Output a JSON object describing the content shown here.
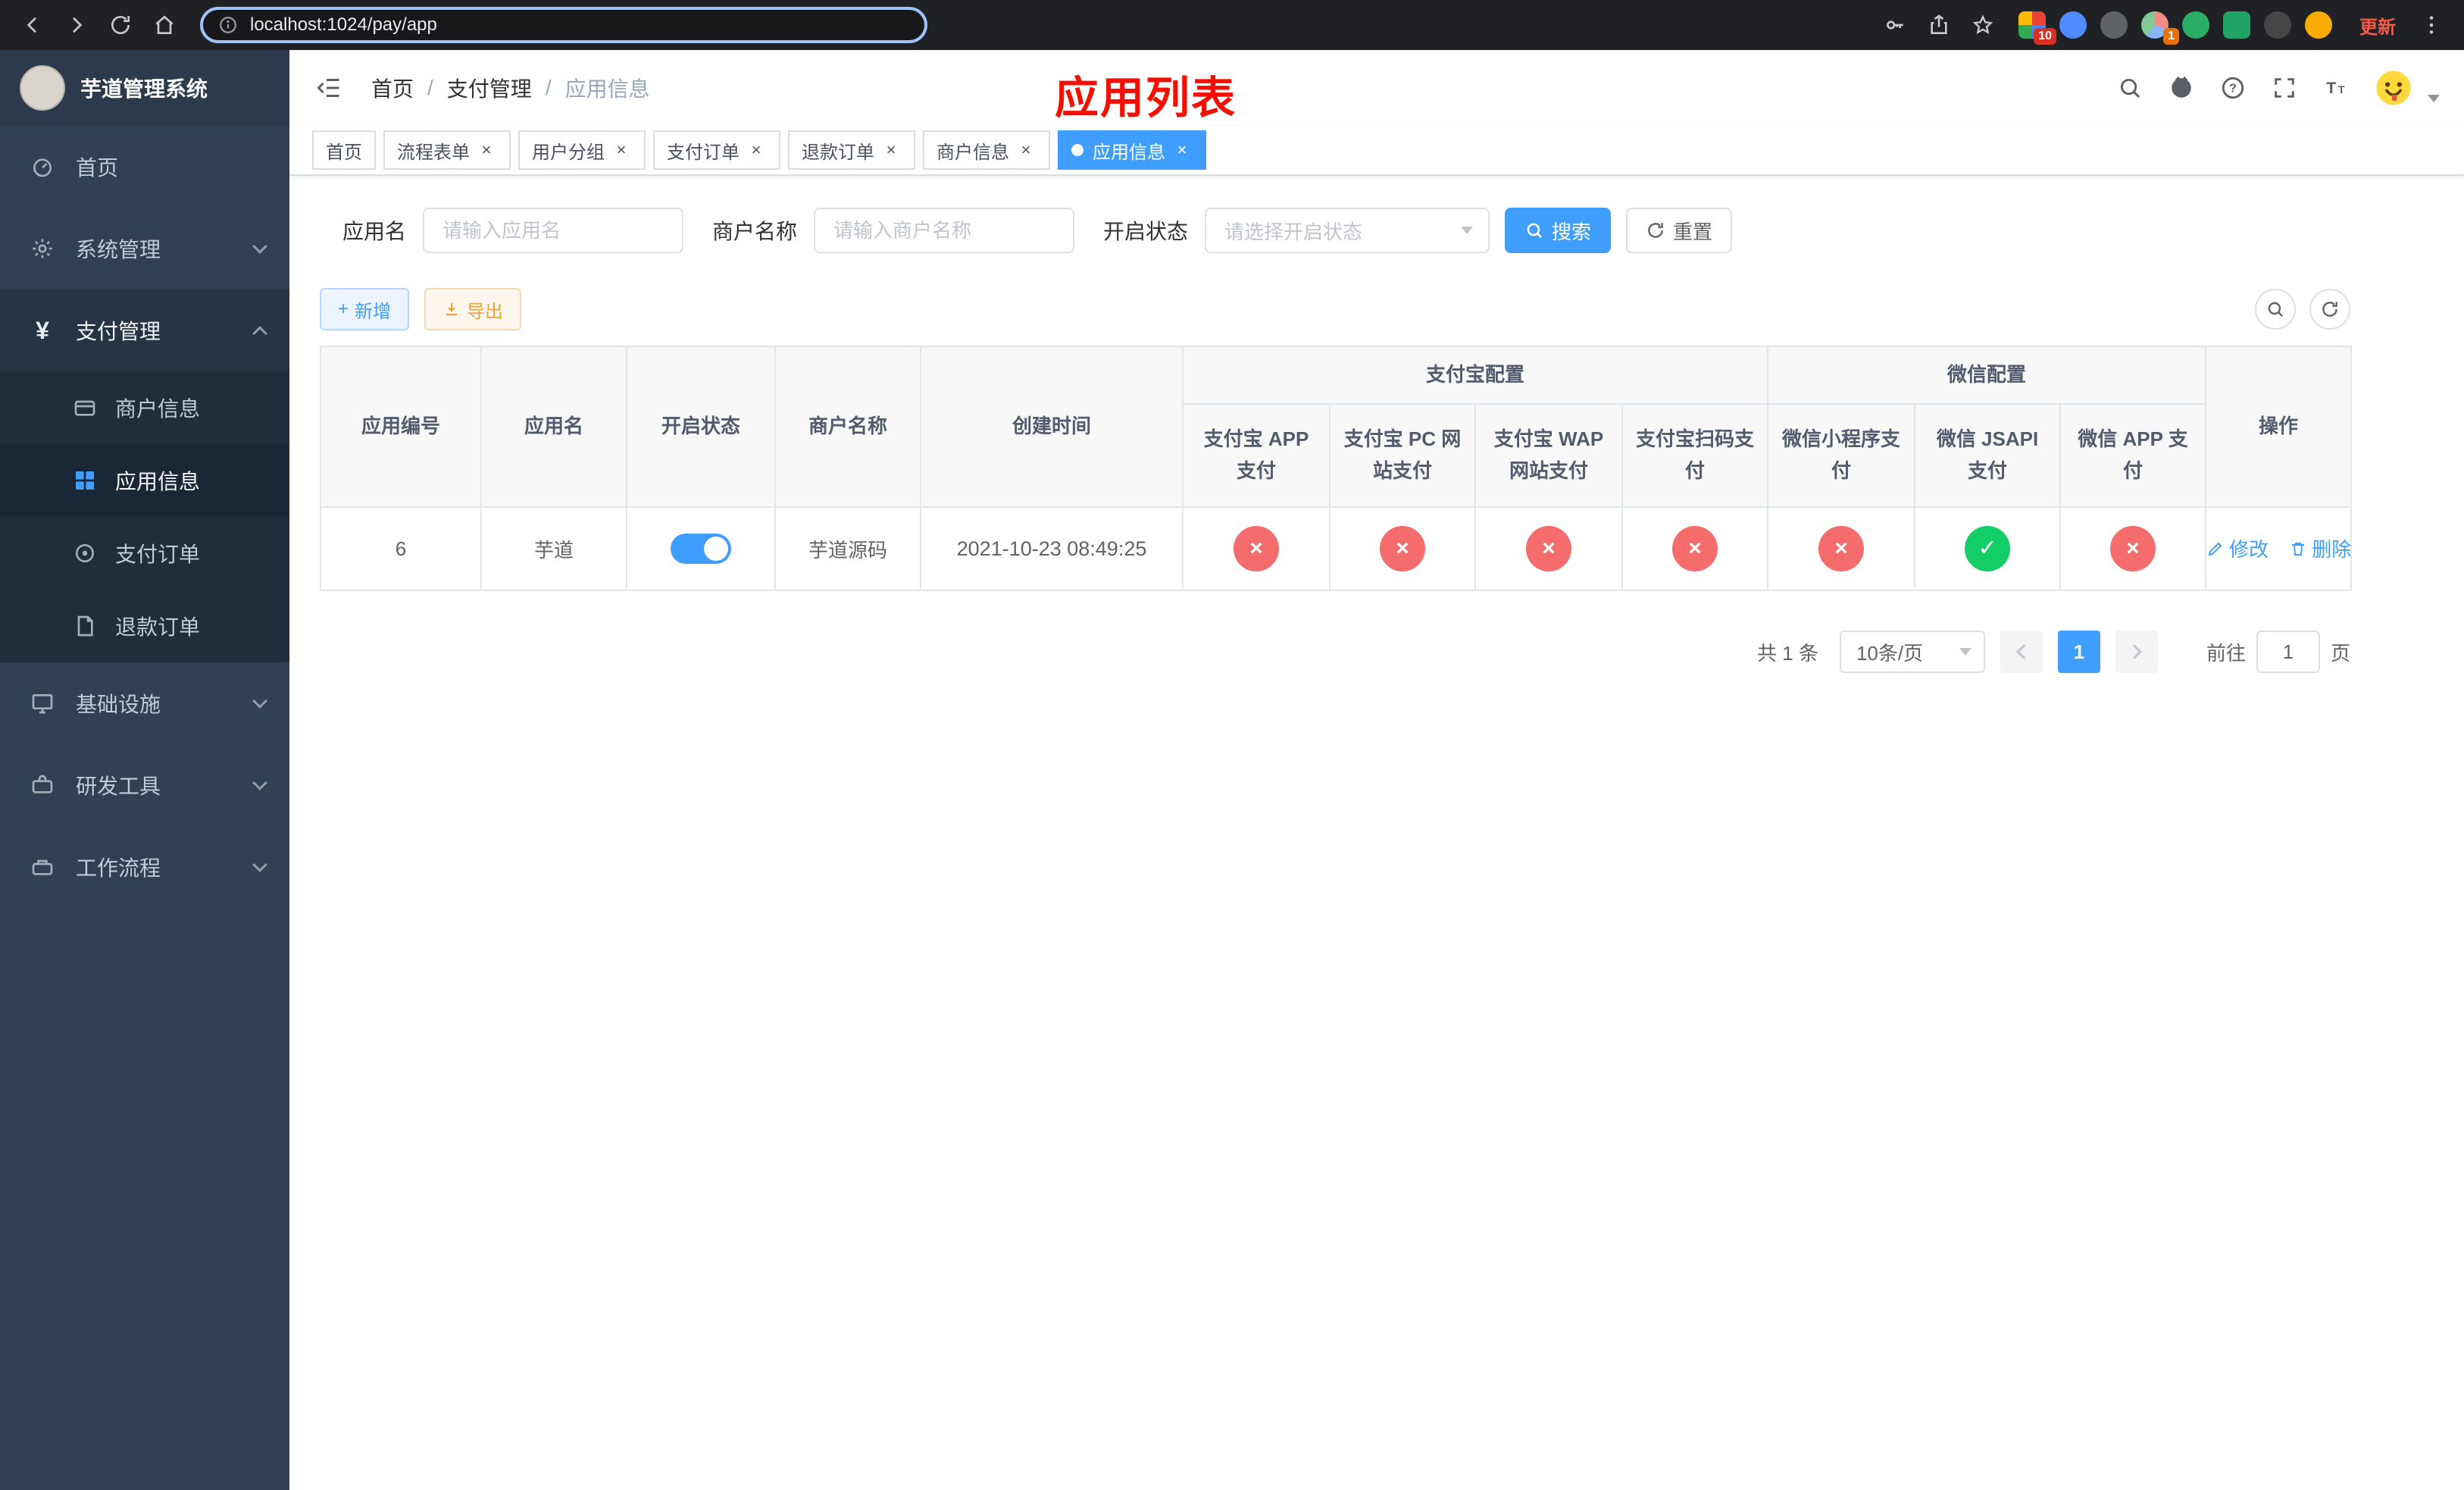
{
  "browser": {
    "url": "localhost:1024/pay/app",
    "update_button": "更新",
    "ext_badge_1": "10",
    "ext_badge_2": "1"
  },
  "overlay_title": "应用列表",
  "sidebar": {
    "app_title": "芋道管理系统",
    "home": "首页",
    "system": "系统管理",
    "payment": "支付管理",
    "merchant_info": "商户信息",
    "app_info": "应用信息",
    "pay_order": "支付订单",
    "refund_order": "退款订单",
    "infra": "基础设施",
    "dev_tools": "研发工具",
    "workflow": "工作流程"
  },
  "breadcrumb": {
    "home": "首页",
    "section": "支付管理",
    "current": "应用信息"
  },
  "tabs": [
    {
      "label": "首页"
    },
    {
      "label": "流程表单"
    },
    {
      "label": "用户分组"
    },
    {
      "label": "支付订单"
    },
    {
      "label": "退款订单"
    },
    {
      "label": "商户信息"
    },
    {
      "label": "应用信息"
    }
  ],
  "filters": {
    "app_name_label": "应用名",
    "app_name_placeholder": "请输入应用名",
    "merchant_name_label": "商户名称",
    "merchant_name_placeholder": "请输入商户名称",
    "status_label": "开启状态",
    "status_placeholder": "请选择开启状态",
    "search_button": "搜索",
    "reset_button": "重置"
  },
  "toolbar": {
    "add_button": "新增",
    "export_button": "导出"
  },
  "table": {
    "group_alipay": "支付宝配置",
    "group_wechat": "微信配置",
    "columns": [
      "应用编号",
      "应用名",
      "开启状态",
      "商户名称",
      "创建时间",
      "支付宝 APP 支付",
      "支付宝 PC 网站支付",
      "支付宝 WAP 网站支付",
      "支付宝扫码支付",
      "微信小程序支付",
      "微信 JSAPI 支付",
      "微信 APP 支付",
      "操作"
    ],
    "row": {
      "id": "6",
      "name": "芋道",
      "switch": "on",
      "merchant": "芋道源码",
      "created": "2021-10-23 08:49:25",
      "alipay_app": "disabled",
      "alipay_pc": "disabled",
      "alipay_wap": "disabled",
      "alipay_qr": "disabled",
      "wechat_lite": "disabled",
      "wechat_jsapi": "enabled",
      "wechat_app": "disabled",
      "edit": "修改",
      "remove": "删除"
    }
  },
  "pagination": {
    "total": "共 1 条",
    "page_size": "10条/页",
    "page": "1",
    "goto_label": "前往",
    "goto_value": "1",
    "unit": "页"
  },
  "icons": {
    "separator": "/",
    "close": "×",
    "check": "✓",
    "cross": "×",
    "plus": "+"
  },
  "colors": {
    "accent": "#409eff",
    "danger": "#f56c6c",
    "success": "#13ce66",
    "warning": "#e6a23c",
    "sidebar_bg": "#304156",
    "submenu_bg": "#1f2d3d",
    "annotation_red": "#f40f00",
    "chrome_bg": "#202124"
  }
}
